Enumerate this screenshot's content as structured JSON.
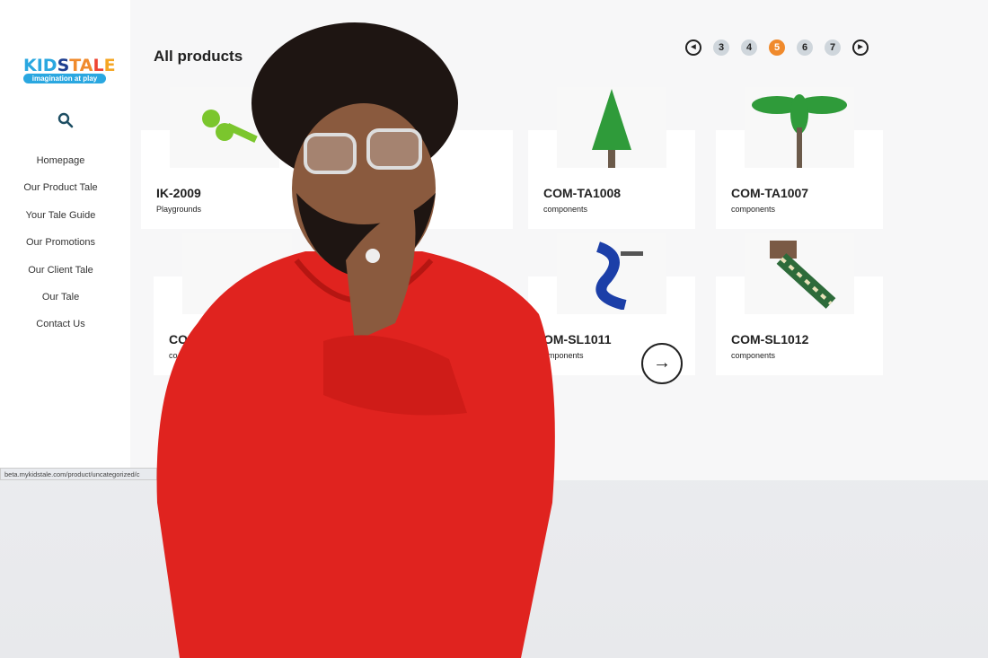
{
  "sidebar": {
    "logo_text": "KIDSTALE",
    "logo_tagline": "imagination at play",
    "search_icon": "search-icon",
    "items": [
      {
        "label": "Homepage"
      },
      {
        "label": "Our Product Tale"
      },
      {
        "label": "Your Tale Guide"
      },
      {
        "label": "Our Promotions"
      },
      {
        "label": "Our Client Tale"
      },
      {
        "label": "Our Tale"
      },
      {
        "label": "Contact Us"
      }
    ]
  },
  "main": {
    "title": "All products",
    "pagination": {
      "pages": [
        "3",
        "4",
        "5",
        "6",
        "7"
      ],
      "current": "5",
      "prev_icon": "prev-icon",
      "next_icon": "next-icon"
    },
    "products": [
      {
        "code": "IK-2009",
        "category": "Playgrounds"
      },
      {
        "code": "",
        "category": ""
      },
      {
        "code": "COM-TA1008",
        "category": "components"
      },
      {
        "code": "COM-TA1007",
        "category": "components"
      },
      {
        "code": "CO",
        "category": "co"
      },
      {
        "code": "",
        "category": ""
      },
      {
        "code": "OM-SL1011",
        "category": "omponents"
      },
      {
        "code": "COM-SL1012",
        "category": "components"
      }
    ],
    "next_button_icon": "arrow-right-icon"
  },
  "status_bar": {
    "url": "beta.mykidstale.com/product/uncategorized/c"
  },
  "colors": {
    "accent": "#f08a2c",
    "pager_bg": "#cfd6dc",
    "hoodie": "#e0231f"
  }
}
